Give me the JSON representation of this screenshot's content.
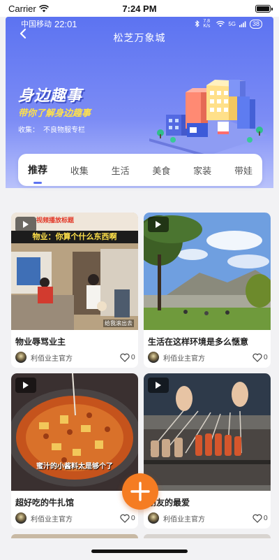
{
  "ios_status": {
    "carrier": "Carrier",
    "time": "7:24 PM"
  },
  "app_status": {
    "carrier": "中国移动",
    "time": "22:01",
    "data_speed": "7.8 K/s",
    "network": "5G",
    "battery": "38"
  },
  "header": {
    "title": "松芝万象城"
  },
  "hero": {
    "title": "身边趣事",
    "subtitle": "带你了解身边趣事",
    "collect_label": "收集：",
    "collect_value": "不良物服专栏"
  },
  "tabs": [
    {
      "label": "推荐",
      "active": true
    },
    {
      "label": "收集",
      "active": false
    },
    {
      "label": "生活",
      "active": false
    },
    {
      "label": "美食",
      "active": false
    },
    {
      "label": "家装",
      "active": false
    },
    {
      "label": "带娃",
      "active": false
    }
  ],
  "posts": [
    {
      "title": "物业辱骂业主",
      "author": "利佰业主官方",
      "likes": "0",
      "caption": "物业：你算个什么东西啊",
      "overlay_top": "视频播放标题",
      "overlay_bottom": "给我滚出去"
    },
    {
      "title": "生活在这样环境是多么惬意",
      "author": "利佰业主官方",
      "likes": "0"
    },
    {
      "title": "超好吃的牛扎馆",
      "author": "利佰业主官方",
      "likes": "0",
      "caption": "蜜汁的小酱料太是够个了"
    },
    {
      "title": "朋友的最爱",
      "author": "利佰业主官方",
      "likes": "0"
    }
  ],
  "colors": {
    "accent": "#5c73f1",
    "fab": "#f57c22",
    "hero_yellow": "#ffe14a"
  }
}
